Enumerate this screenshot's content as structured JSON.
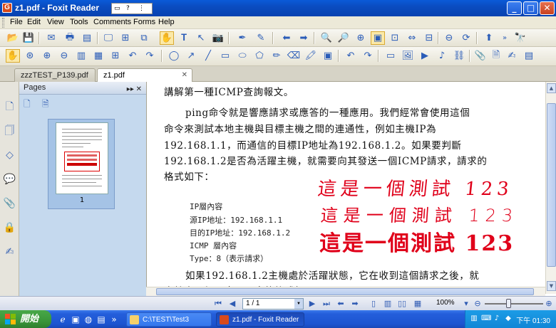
{
  "window": {
    "title": "z1.pdf - Foxit Reader",
    "app_icon_letter": "G",
    "controls": {
      "minimize": "_",
      "maximize": "□",
      "close": "✕"
    }
  },
  "menubar": {
    "items": [
      {
        "label": "File"
      },
      {
        "label": "Edit"
      },
      {
        "label": "View"
      },
      {
        "label": "Tools"
      },
      {
        "label": "Comments"
      },
      {
        "label": "Forms"
      },
      {
        "label": "Help"
      }
    ]
  },
  "tabs": [
    {
      "label": "zzzTEST_P139.pdf",
      "active": false
    },
    {
      "label": "z1.pdf",
      "active": true
    }
  ],
  "pages_panel": {
    "title": "Pages",
    "thumbnail_page_number": "1"
  },
  "document": {
    "paragraphs": [
      "講解第一種ICMP查詢報文。",
      "ping命令就是響應請求或應答的一種應用。我們經常會使用這個",
      "命令來測試本地主機與目標主機之間的連通性，例如主機IP為",
      "192.168.1.1，而通信的目標IP地址為192.168.1.2。如果要判斷",
      "192.168.1.2是否為活躍主機，就需要向其發送一個ICMP請求，請求的",
      "格式如下："
    ],
    "packet_lines": [
      "IP層內容",
      "源IP地址：192.168.1.1",
      "目的IP地址：192.168.1.2",
      "ICMP 層內容",
      "Type：8（表示請求）"
    ],
    "trailing_paragraphs": [
      "如果192.168.1.2主機處於活躍狀態，它在收到這個請求之後，就",
      "會給出一個回應，回應的格式如下："
    ],
    "handwriting": [
      "這是一個測試 123",
      "這是一個測試 123",
      "這是一個測試 123"
    ],
    "handwriting_color": "#e0001a"
  },
  "statusbar": {
    "page_indicator": "1 / 1",
    "zoom": "100%"
  },
  "taskbar": {
    "start_label": "開始",
    "tasks": [
      {
        "label": "C:\\TEST\\Test3",
        "active": false
      },
      {
        "label": "z1.pdf - Foxit Reader",
        "active": true
      }
    ],
    "clock": "下午 01:30"
  }
}
